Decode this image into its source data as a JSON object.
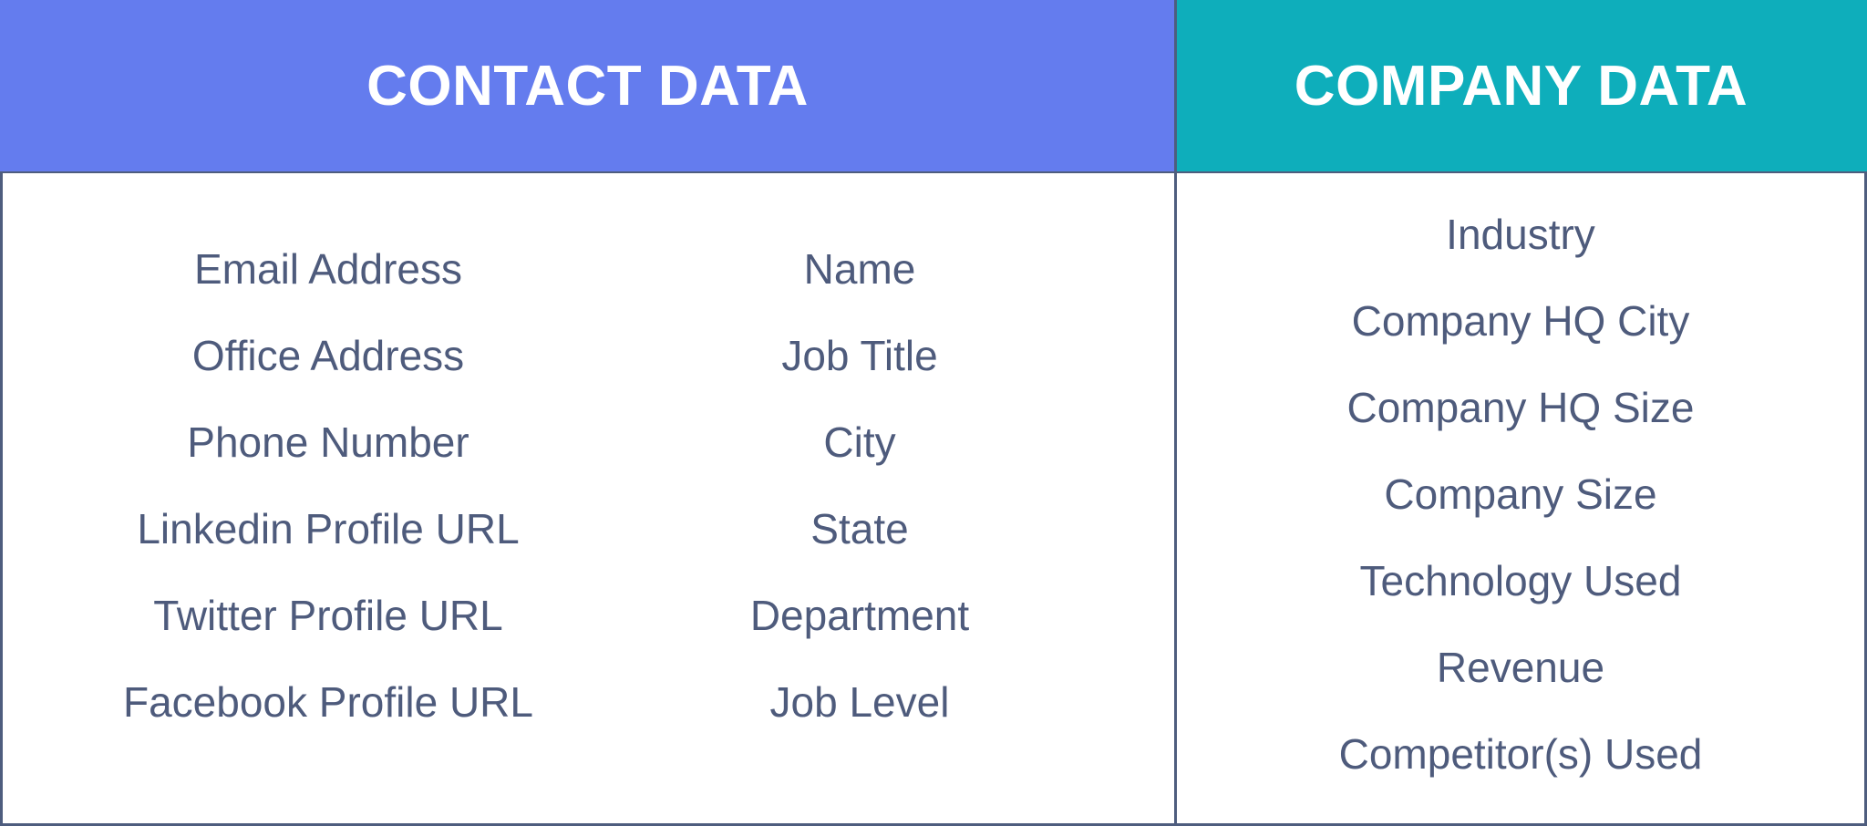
{
  "colors": {
    "contact_header": "#647cee",
    "company_header": "#0eaebb",
    "border": "#4e5d7e",
    "item_text": "#4e5b7c",
    "header_text": "#ffffff"
  },
  "contact": {
    "title": "CONTACT DATA",
    "left_items": [
      "Email Address",
      "Office Address",
      "Phone Number",
      "Linkedin Profile URL",
      "Twitter Profile URL",
      "Facebook Profile URL"
    ],
    "right_items": [
      "Name",
      "Job Title",
      "City",
      "State",
      "Department",
      "Job Level"
    ]
  },
  "company": {
    "title": "COMPANY DATA",
    "items": [
      "Industry",
      "Company HQ City",
      "Company HQ Size",
      "Company Size",
      "Technology Used",
      "Revenue",
      "Competitor(s) Used"
    ]
  }
}
